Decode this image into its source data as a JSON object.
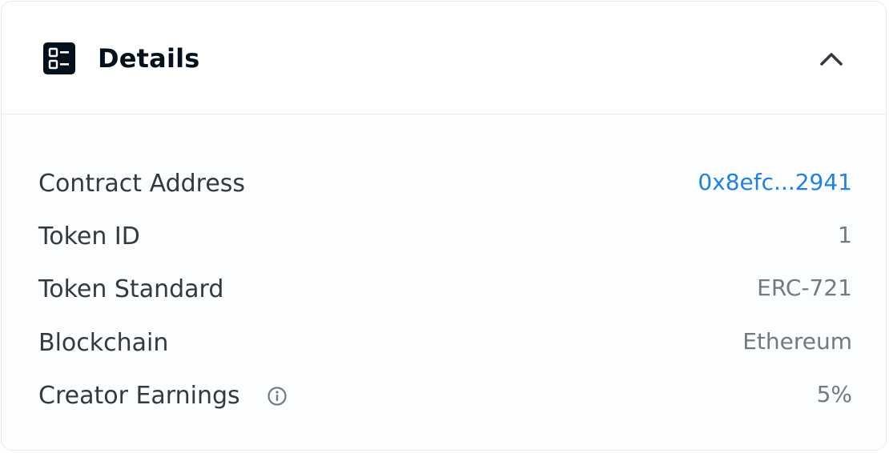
{
  "header": {
    "icon": "details-list-icon",
    "title": "Details",
    "toggle_icon": "chevron-up-icon"
  },
  "colors": {
    "title_text": "#04111d",
    "label_text": "#353840",
    "value_text": "#707a83",
    "link_text": "#2081e2",
    "body_background": "#fbfdff",
    "border": "#e5e8eb"
  },
  "details": {
    "contract_address": {
      "label": "Contract Address",
      "value": "0x8efc...2941"
    },
    "token_id": {
      "label": "Token ID",
      "value": "1"
    },
    "token_standard": {
      "label": "Token Standard",
      "value": "ERC-721"
    },
    "blockchain": {
      "label": "Blockchain",
      "value": "Ethereum"
    },
    "creator_earnings": {
      "label": "Creator Earnings",
      "value": "5%",
      "info_icon": "info-icon"
    }
  }
}
